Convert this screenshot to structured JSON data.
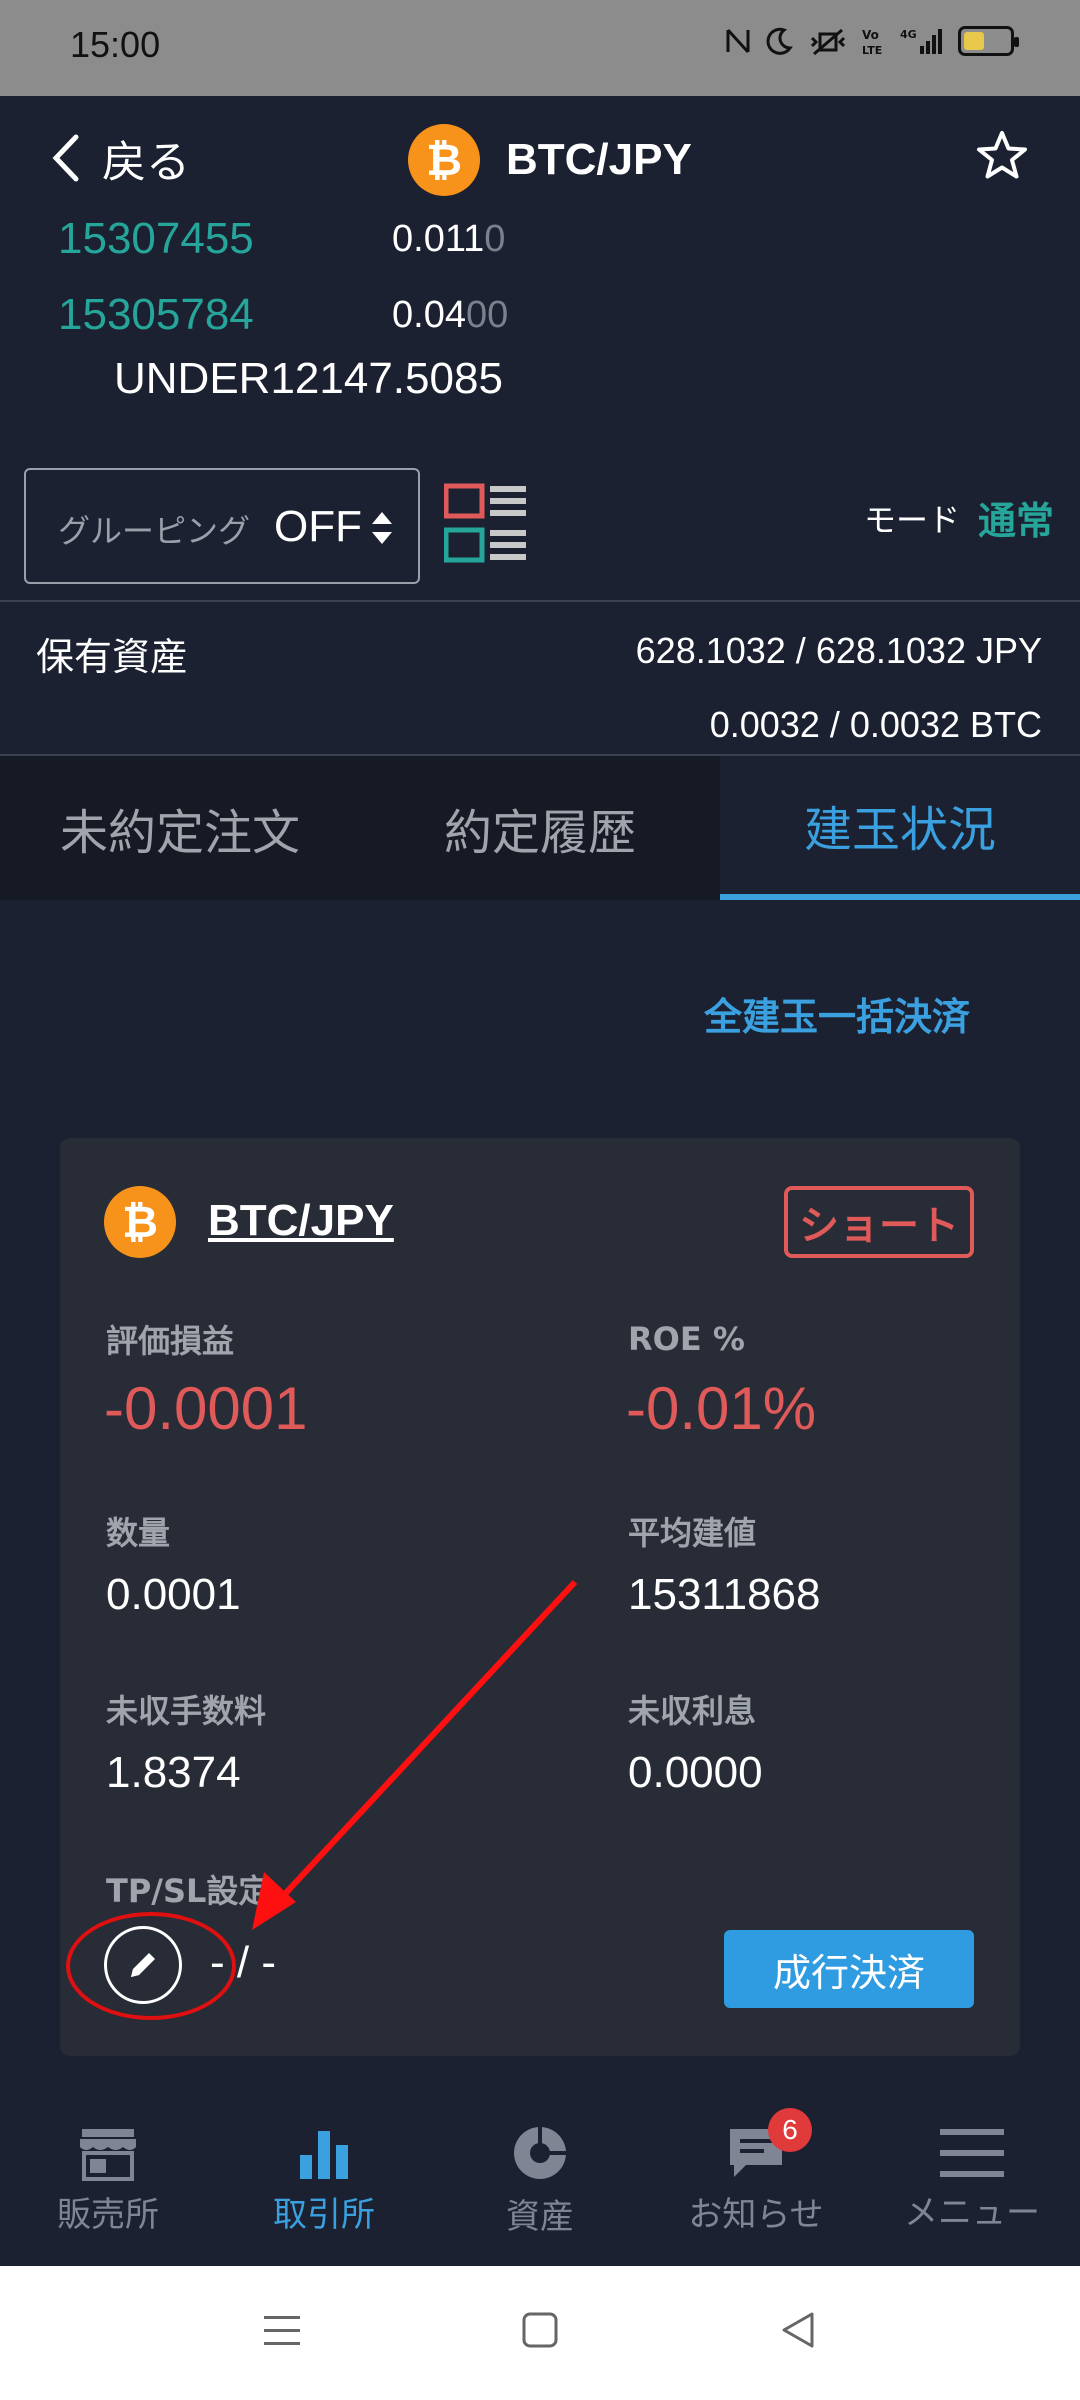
{
  "status_bar": {
    "time": "15:00",
    "icons": [
      "nfc-icon",
      "moon-icon",
      "vibrate-icon",
      "volte-icon",
      "signal-4g-icon",
      "battery-icon"
    ]
  },
  "header": {
    "back_label": "戻る",
    "title": "BTC/JPY",
    "coin_symbol": "₿"
  },
  "orderbook": {
    "rows": [
      {
        "price": "15307455",
        "qty_main": "0.011",
        "qty_dim": "0"
      },
      {
        "price": "15305784",
        "qty_main": "0.04",
        "qty_dim": "00"
      }
    ],
    "under": "UNDER12147.5085"
  },
  "grouping": {
    "label": "グルーピング",
    "value": "OFF"
  },
  "mode": {
    "label": "モード",
    "value": "通常"
  },
  "assets": {
    "label": "保有資産",
    "jpy": "628.1032 / 628.1032  JPY",
    "btc": "0.0032 / 0.0032  BTC"
  },
  "tabs": [
    "未約定注文",
    "約定履歴",
    "建玉状況"
  ],
  "close_all_label": "全建玉一括決済",
  "position": {
    "pair": "BTC/JPY",
    "side": "ショート",
    "fields": {
      "pnl_label": "評価損益",
      "pnl_value": "-0.0001",
      "roe_label": "ROE %",
      "roe_value": "-0.01%",
      "qty_label": "数量",
      "qty_value": "0.0001",
      "avg_label": "平均建値",
      "avg_value": "15311868",
      "fee_label": "未収手数料",
      "fee_value": "1.8374",
      "interest_label": "未収利息",
      "interest_value": "0.0000"
    },
    "tpsl_label": "TP/SL設定",
    "tpsl_value": "- / -",
    "market_close_label": "成行決済"
  },
  "bottom_nav": [
    {
      "label": "販売所",
      "icon": "store-icon"
    },
    {
      "label": "取引所",
      "icon": "bar-chart-icon"
    },
    {
      "label": "資産",
      "icon": "pie-chart-icon"
    },
    {
      "label": "お知らせ",
      "icon": "message-icon",
      "badge": "6"
    },
    {
      "label": "メニュー",
      "icon": "menu-icon"
    }
  ],
  "colors": {
    "accent": "#3aa0e0",
    "buy_green": "#26a69a",
    "sell_red": "#e05a5a",
    "btc_orange": "#f7931a"
  }
}
